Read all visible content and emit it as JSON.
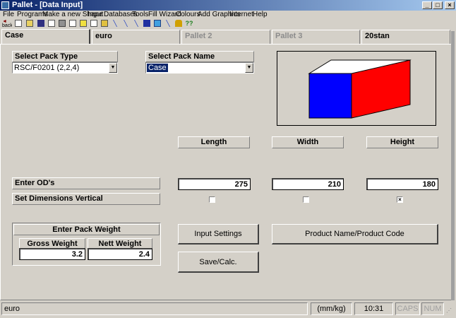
{
  "window": {
    "title": "Pallet - [Data Input]"
  },
  "menu": [
    "File",
    "Programs",
    "Make a new Shape",
    "Input",
    "Databases",
    "Tools",
    "Fill Wizard",
    "Colours",
    "Add Graphics",
    "Internet",
    "Help"
  ],
  "toolbar": {
    "back_label": "back",
    "icons": [
      "new-icon",
      "open-icon",
      "save-icon",
      "print-preview-icon",
      "print-icon",
      "document-icon",
      "copy-icon",
      "report-icon",
      "database-icon",
      "wand-icon",
      "wand-icon",
      "wand-icon",
      "book-icon",
      "box-icon",
      "wand-icon",
      "bottle-icon",
      "help-icon"
    ]
  },
  "tabs": [
    {
      "label": "Case",
      "state": "active"
    },
    {
      "label": "euro",
      "state": "normal"
    },
    {
      "label": "Pallet 2",
      "state": "disabled"
    },
    {
      "label": "Pallet 3",
      "state": "disabled"
    },
    {
      "label": "20stan",
      "state": "normal"
    }
  ],
  "pack_type": {
    "label": "Select Pack Type",
    "value": "RSC/F0201 (2,2,4)"
  },
  "pack_name": {
    "label": "Select Pack Name",
    "value": "Case"
  },
  "box_colors": {
    "top": "#ffffff",
    "front": "#0000ff",
    "side": "#ff0000"
  },
  "dimensions": {
    "headers": {
      "length": "Length",
      "width": "Width",
      "height": "Height"
    },
    "od_label": "Enter OD's",
    "vertical_label": "Set Dimensions Vertical",
    "length": "275",
    "width": "210",
    "height": "180",
    "vertical": {
      "length": false,
      "width": false,
      "height": true
    }
  },
  "weight": {
    "title": "Enter Pack Weight",
    "gross_label": "Gross Weight",
    "gross_value": "3.2",
    "nett_label": "Nett Weight",
    "nett_value": "2.4"
  },
  "buttons": {
    "input_settings": "Input Settings",
    "product_name": "Product Name/Product Code",
    "save_calc": "Save/Calc."
  },
  "status": {
    "pallet": "euro",
    "units": "(mm/kg)",
    "time": "10:31",
    "caps": "CAPS",
    "num": "NUM"
  }
}
